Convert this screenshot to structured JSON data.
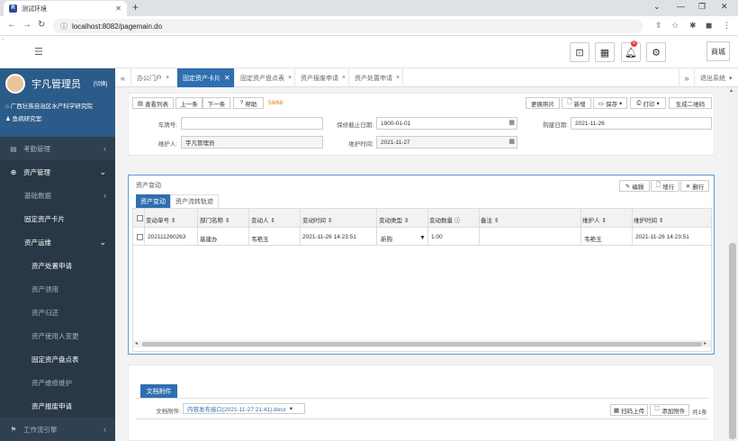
{
  "browser": {
    "tab_title": "测试环境",
    "favicon": "R",
    "url": "localhost:8082/pagemain.do"
  },
  "header": {
    "shop_label": "商城",
    "notify_count": "0"
  },
  "sidebar": {
    "user_name": "宇凡管理员",
    "switch_label": "[切换]",
    "org": "广西壮族自治区水产科学研究院",
    "dept": "鱼病研究室:",
    "menus": [
      {
        "label": "考勤管理"
      },
      {
        "label": "资产管理"
      },
      {
        "label": "基础数据"
      },
      {
        "label": "固定资产卡片"
      },
      {
        "label": "资产运维"
      },
      {
        "label": "资产处置申请"
      },
      {
        "label": "资产领用"
      },
      {
        "label": "资产归还"
      },
      {
        "label": "资产使用人变更"
      },
      {
        "label": "固定资产盘点表"
      },
      {
        "label": "资产维修维护"
      },
      {
        "label": "资产报废申请"
      },
      {
        "label": "工作流引擎"
      }
    ]
  },
  "tabs": {
    "items": [
      "办公门户",
      "固定资产卡片",
      "固定资产盘点表",
      "资产报废申请",
      "资产处置申请"
    ],
    "logout": "退出系统"
  },
  "toolbar": {
    "view_list": "查看列表",
    "prev": "上一条",
    "next": "下一条",
    "help": "帮助",
    "pager": "59/68",
    "change_photo": "更换照片",
    "add": "新增",
    "save": "保存",
    "print": "打印",
    "gen_qr": "生成二维码"
  },
  "form": {
    "plate_label": "车牌号:",
    "plate_value": "",
    "warranty_label": "保修截止日期:",
    "warranty_value": "1900-01-01",
    "build_label": "购建日期:",
    "build_value": "2021-11-26",
    "maint_label": "维护人:",
    "maint_value": "宇凡管理员",
    "mtime_label": "维护时间:",
    "mtime_value": "2021-11-27"
  },
  "change": {
    "section_title": "资产变动",
    "edit": "编辑",
    "add_row": "增行",
    "del_row": "删行",
    "tabs": [
      "资产变动",
      "资产流转轨迹"
    ],
    "columns": [
      "变动单号",
      "部门名称",
      "变动人",
      "变动时间",
      "变动类型",
      "变动数量",
      "备注",
      "维护人",
      "维护时间"
    ],
    "rows": [
      [
        "202111260263",
        "基建办",
        "韦艳玉",
        "2021-11-26 14:23:51",
        "新购",
        "1.00",
        "",
        "韦艳玉",
        "2021-11-26 14:23:51"
      ]
    ]
  },
  "attach": {
    "tab": "文档附件",
    "label": "文档附件:",
    "file": "内容发布接口(2021-11-27 21:41).docx",
    "scan_upload": "扫码上传",
    "add_attach": "添加附件",
    "count": "共1条"
  },
  "colors": {
    "sidebar": "#2f4050",
    "user_panel": "#2b5b88",
    "accent": "#2f6fb0",
    "pager": "#e07b00"
  }
}
